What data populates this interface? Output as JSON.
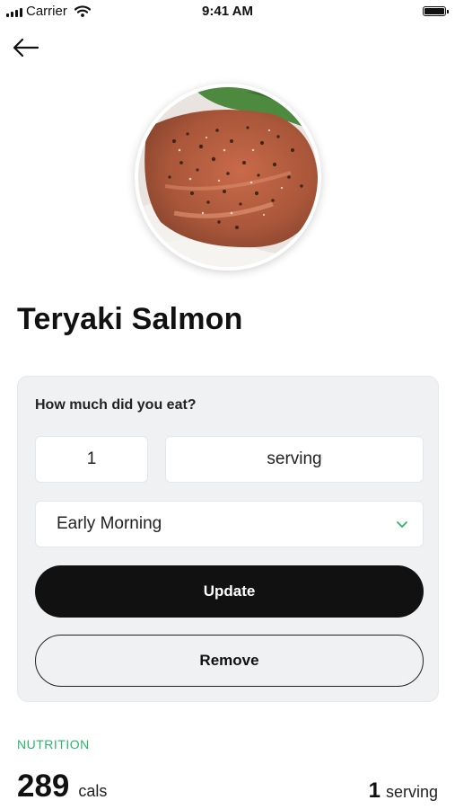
{
  "status_bar": {
    "carrier": "Carrier",
    "time": "9:41 AM",
    "signal_icon": "signal-bars-icon",
    "wifi_icon": "wifi-icon",
    "battery_icon": "battery-icon",
    "battery_level": 1.0
  },
  "nav": {
    "back_icon": "arrow-left-icon"
  },
  "food": {
    "name": "Teryaki Salmon",
    "image": "teryaki-salmon-photo"
  },
  "log_card": {
    "question": "How much did you eat?",
    "quantity_value": "1",
    "unit_value": "serving",
    "meal_value": "Early Morning",
    "meal_dropdown_icon": "chevron-down-icon",
    "update_label": "Update",
    "remove_label": "Remove"
  },
  "nutrition": {
    "section_label": "NUTRITION",
    "calories_value": "289",
    "calories_unit": "cals",
    "serving_value": "1",
    "serving_unit": "serving"
  },
  "colors": {
    "accent_green": "#2bb56b",
    "primary_button": "#111111",
    "card_background": "#eff1f3"
  }
}
